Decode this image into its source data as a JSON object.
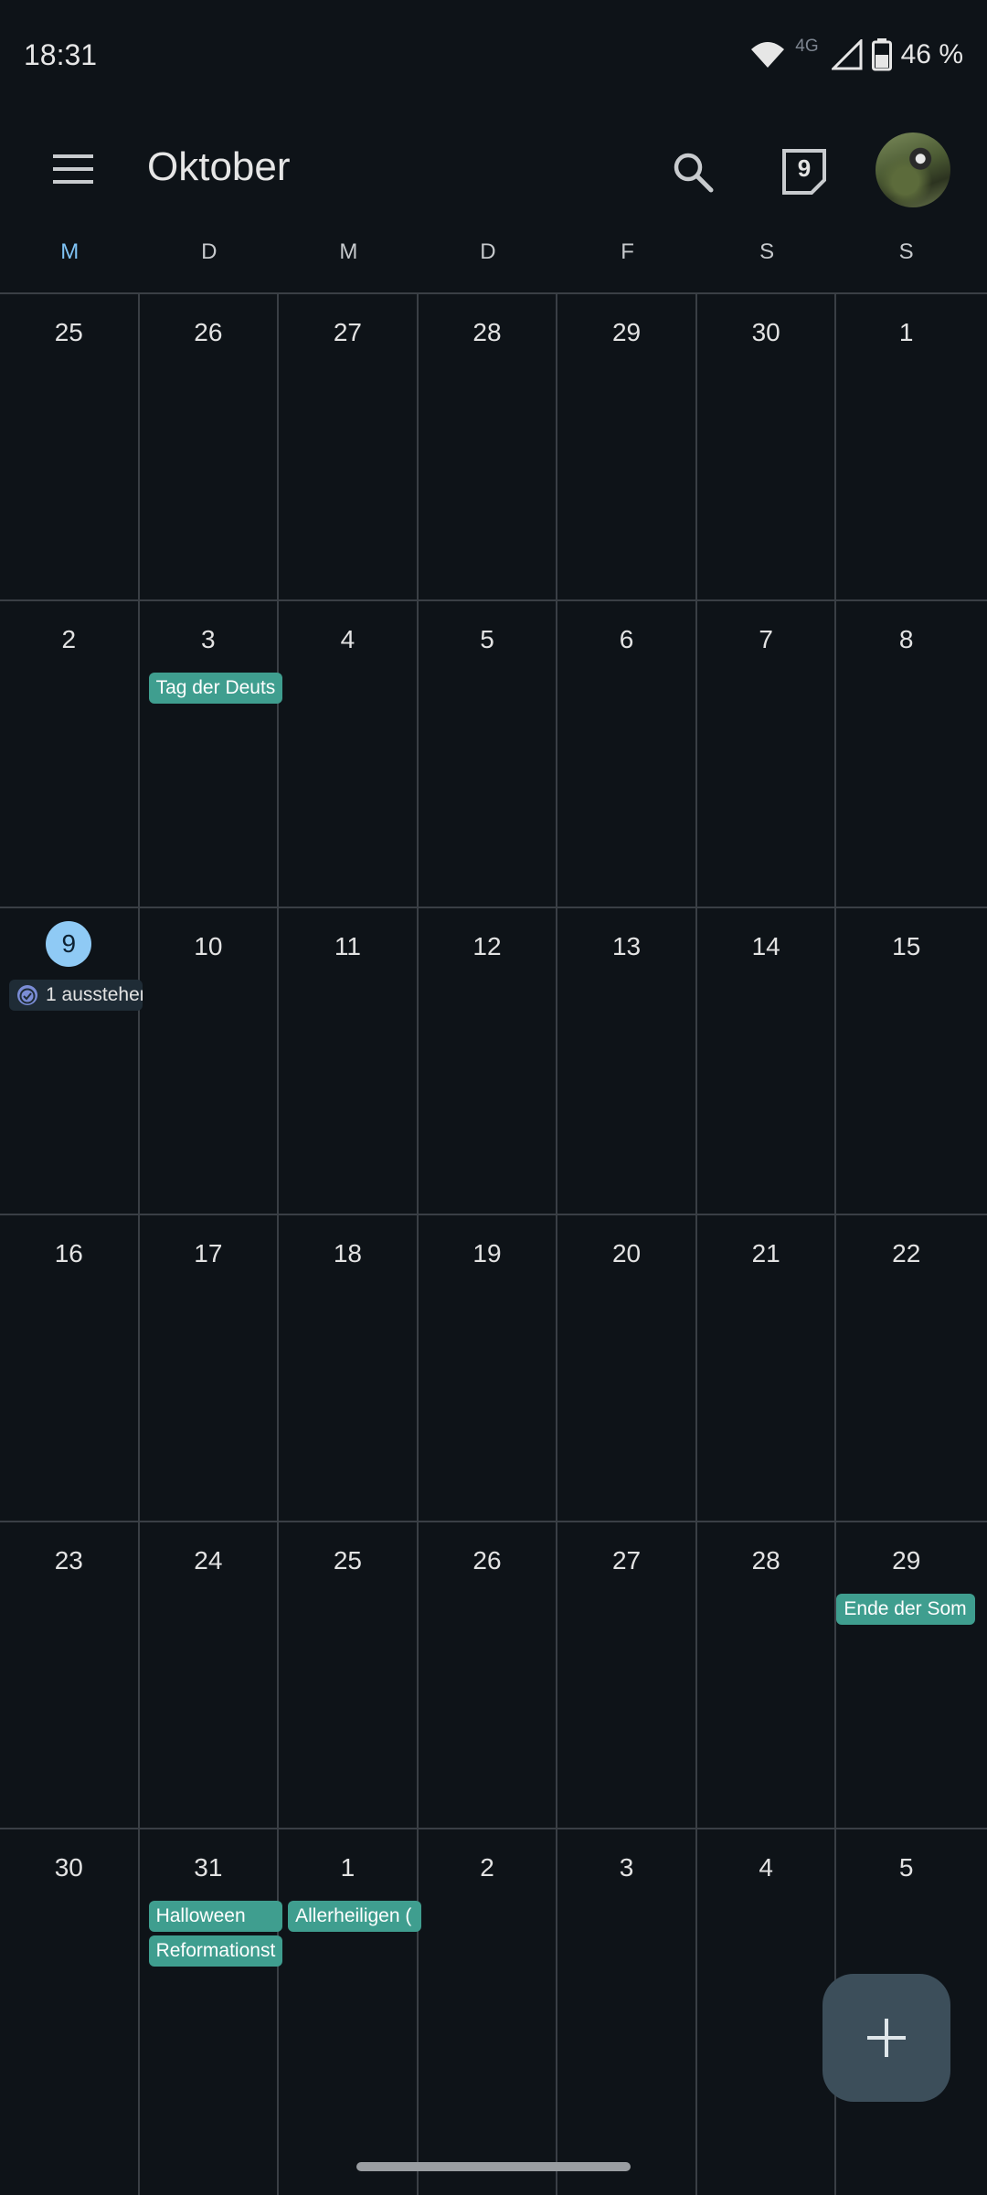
{
  "status_bar": {
    "time": "18:31",
    "network": "4G",
    "battery": "46 %",
    "icons": [
      "wifi-icon",
      "signal-icon",
      "battery-icon"
    ]
  },
  "app_bar": {
    "month": "Oktober",
    "today_day": "9",
    "icons": [
      "menu-icon",
      "search-icon",
      "today-calendar-icon",
      "avatar"
    ]
  },
  "weekdays": [
    "M",
    "D",
    "M",
    "D",
    "F",
    "S",
    "S"
  ],
  "weeks": [
    [
      "25",
      "26",
      "27",
      "28",
      "29",
      "30",
      "1"
    ],
    [
      "2",
      "3",
      "4",
      "5",
      "6",
      "7",
      "8"
    ],
    [
      "9",
      "10",
      "11",
      "12",
      "13",
      "14",
      "15"
    ],
    [
      "16",
      "17",
      "18",
      "19",
      "20",
      "21",
      "22"
    ],
    [
      "23",
      "24",
      "25",
      "26",
      "27",
      "28",
      "29"
    ],
    [
      "30",
      "31",
      "1",
      "2",
      "3",
      "4",
      "5"
    ]
  ],
  "events": {
    "tag_der_deutschen_einheit": "Tag der Deuts",
    "task_pending": "1 ausstehen",
    "ende_der_sommerzeit": "Ende der Som",
    "halloween": "Halloween",
    "reformationstag": "Reformationst",
    "allerheiligen": "Allerheiligen ("
  },
  "colors": {
    "event_chip": "#3f9e8f",
    "today_highlight": "#8fcaf5",
    "background": "#0e1318"
  },
  "fab": {
    "icon": "plus-icon"
  }
}
